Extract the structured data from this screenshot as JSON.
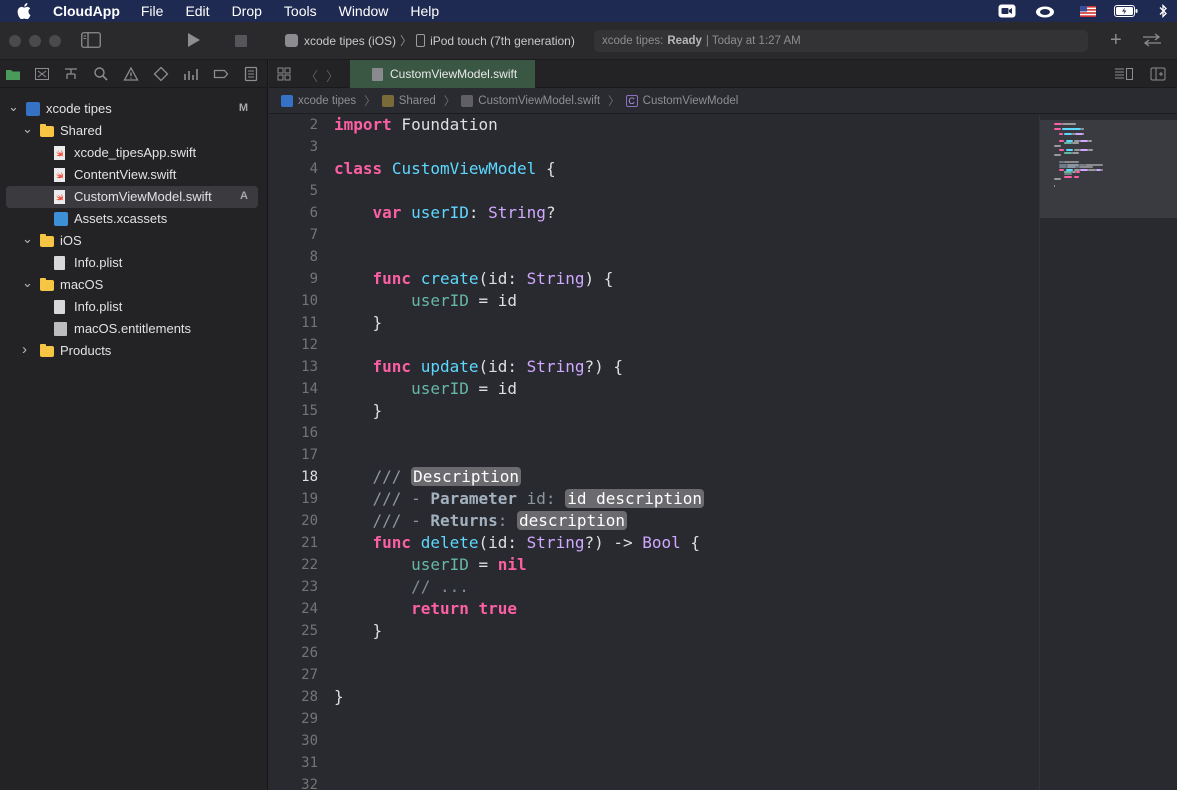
{
  "menubar": {
    "app_name": "CloudApp",
    "menus": [
      "File",
      "Edit",
      "Drop",
      "Tools",
      "Window",
      "Help"
    ]
  },
  "toolbar": {
    "scheme": "xcode tipes (iOS)",
    "destination": "iPod touch (7th generation)",
    "activity_prefix": "xcode tipes:",
    "activity_status": "Ready",
    "activity_time": "| Today at 1:27 AM"
  },
  "navigator": {
    "items": [
      {
        "label": "xcode tipes",
        "badge": "M",
        "indent": 0,
        "kind": "project",
        "chevron": "open"
      },
      {
        "label": "Shared",
        "badge": "",
        "indent": 1,
        "kind": "folder",
        "chevron": "open"
      },
      {
        "label": "xcode_tipesApp.swift",
        "badge": "",
        "indent": 2,
        "kind": "swift",
        "chevron": ""
      },
      {
        "label": "ContentView.swift",
        "badge": "",
        "indent": 2,
        "kind": "swift",
        "chevron": ""
      },
      {
        "label": "CustomViewModel.swift",
        "badge": "A",
        "indent": 2,
        "kind": "swift",
        "chevron": "",
        "selected": true
      },
      {
        "label": "Assets.xcassets",
        "badge": "",
        "indent": 2,
        "kind": "assets",
        "chevron": ""
      },
      {
        "label": "iOS",
        "badge": "",
        "indent": 1,
        "kind": "folder",
        "chevron": "open"
      },
      {
        "label": "Info.plist",
        "badge": "",
        "indent": 2,
        "kind": "plist",
        "chevron": ""
      },
      {
        "label": "macOS",
        "badge": "",
        "indent": 1,
        "kind": "folder",
        "chevron": "open"
      },
      {
        "label": "Info.plist",
        "badge": "",
        "indent": 2,
        "kind": "plist",
        "chevron": ""
      },
      {
        "label": "macOS.entitlements",
        "badge": "",
        "indent": 2,
        "kind": "entitlements",
        "chevron": ""
      },
      {
        "label": "Products",
        "badge": "",
        "indent": 1,
        "kind": "folder",
        "chevron": "closed"
      }
    ]
  },
  "editor": {
    "tab_label": "CustomViewModel.swift",
    "jumpbar": [
      "xcode tipes",
      "Shared",
      "CustomViewModel.swift",
      "CustomViewModel"
    ],
    "current_line": "18",
    "lines": [
      {
        "n": "2",
        "tokens": [
          [
            "kw",
            "import"
          ],
          [
            "pl",
            " Foundation"
          ]
        ]
      },
      {
        "n": "3",
        "tokens": []
      },
      {
        "n": "4",
        "tokens": [
          [
            "kw",
            "class"
          ],
          [
            "pl",
            " "
          ],
          [
            "dc",
            "CustomViewModel"
          ],
          [
            "pl",
            " {"
          ]
        ]
      },
      {
        "n": "5",
        "tokens": []
      },
      {
        "n": "6",
        "tokens": [
          [
            "pl",
            "    "
          ],
          [
            "kw",
            "var"
          ],
          [
            "pl",
            " "
          ],
          [
            "dc",
            "userID"
          ],
          [
            "pl",
            ": "
          ],
          [
            "ty",
            "String"
          ],
          [
            "pl",
            "?"
          ]
        ]
      },
      {
        "n": "7",
        "tokens": []
      },
      {
        "n": "8",
        "tokens": []
      },
      {
        "n": "9",
        "tokens": [
          [
            "pl",
            "    "
          ],
          [
            "kw",
            "func"
          ],
          [
            "pl",
            " "
          ],
          [
            "dc",
            "create"
          ],
          [
            "pl",
            "(id: "
          ],
          [
            "ty",
            "String"
          ],
          [
            "pl",
            ") {"
          ]
        ]
      },
      {
        "n": "10",
        "tokens": [
          [
            "pl",
            "        "
          ],
          [
            "id",
            "userID"
          ],
          [
            "pl",
            " = id"
          ]
        ]
      },
      {
        "n": "11",
        "tokens": [
          [
            "pl",
            "    }"
          ]
        ]
      },
      {
        "n": "12",
        "tokens": []
      },
      {
        "n": "13",
        "tokens": [
          [
            "pl",
            "    "
          ],
          [
            "kw",
            "func"
          ],
          [
            "pl",
            " "
          ],
          [
            "dc",
            "update"
          ],
          [
            "pl",
            "(id: "
          ],
          [
            "ty",
            "String"
          ],
          [
            "pl",
            "?) {"
          ]
        ]
      },
      {
        "n": "14",
        "tokens": [
          [
            "pl",
            "        "
          ],
          [
            "id",
            "userID"
          ],
          [
            "pl",
            " = id"
          ]
        ]
      },
      {
        "n": "15",
        "tokens": [
          [
            "pl",
            "    }"
          ]
        ]
      },
      {
        "n": "16",
        "tokens": []
      },
      {
        "n": "17",
        "tokens": []
      },
      {
        "n": "18",
        "tokens": [
          [
            "pl",
            "    "
          ],
          [
            "dm",
            "/// "
          ],
          [
            "ph",
            "Description"
          ]
        ]
      },
      {
        "n": "19",
        "tokens": [
          [
            "pl",
            "    "
          ],
          [
            "dm",
            "/// - "
          ],
          [
            "dmk",
            "Parameter"
          ],
          [
            "dm",
            " id: "
          ],
          [
            "ph",
            "id description"
          ]
        ]
      },
      {
        "n": "20",
        "tokens": [
          [
            "pl",
            "    "
          ],
          [
            "dm",
            "/// - "
          ],
          [
            "dmk",
            "Returns"
          ],
          [
            "dm",
            ": "
          ],
          [
            "ph",
            "description"
          ]
        ]
      },
      {
        "n": "21",
        "tokens": [
          [
            "pl",
            "    "
          ],
          [
            "kw",
            "func"
          ],
          [
            "pl",
            " "
          ],
          [
            "dc",
            "delete"
          ],
          [
            "pl",
            "(id: "
          ],
          [
            "ty",
            "String"
          ],
          [
            "pl",
            "?) -> "
          ],
          [
            "ty",
            "Bool"
          ],
          [
            "pl",
            " {"
          ]
        ]
      },
      {
        "n": "22",
        "tokens": [
          [
            "pl",
            "        "
          ],
          [
            "id",
            "userID"
          ],
          [
            "pl",
            " = "
          ],
          [
            "kw",
            "nil"
          ]
        ]
      },
      {
        "n": "23",
        "tokens": [
          [
            "pl",
            "        "
          ],
          [
            "cm",
            "// ..."
          ]
        ]
      },
      {
        "n": "24",
        "tokens": [
          [
            "pl",
            "        "
          ],
          [
            "kw",
            "return"
          ],
          [
            "pl",
            " "
          ],
          [
            "kw",
            "true"
          ]
        ]
      },
      {
        "n": "25",
        "tokens": [
          [
            "pl",
            "    }"
          ]
        ]
      },
      {
        "n": "26",
        "tokens": []
      },
      {
        "n": "27",
        "tokens": []
      },
      {
        "n": "28",
        "tokens": [
          [
            "pl",
            "}"
          ]
        ]
      },
      {
        "n": "29",
        "tokens": []
      },
      {
        "n": "30",
        "tokens": []
      },
      {
        "n": "31",
        "tokens": []
      },
      {
        "n": "32",
        "tokens": []
      }
    ]
  },
  "colors": {
    "keyword": "#fc5fa3",
    "type": "#d0a8ff",
    "declaration": "#5dd8ff",
    "identifier": "#67b7a4",
    "comment": "#7f8c98",
    "editor_bg": "#292a30",
    "active_tab": "#3a5743"
  }
}
